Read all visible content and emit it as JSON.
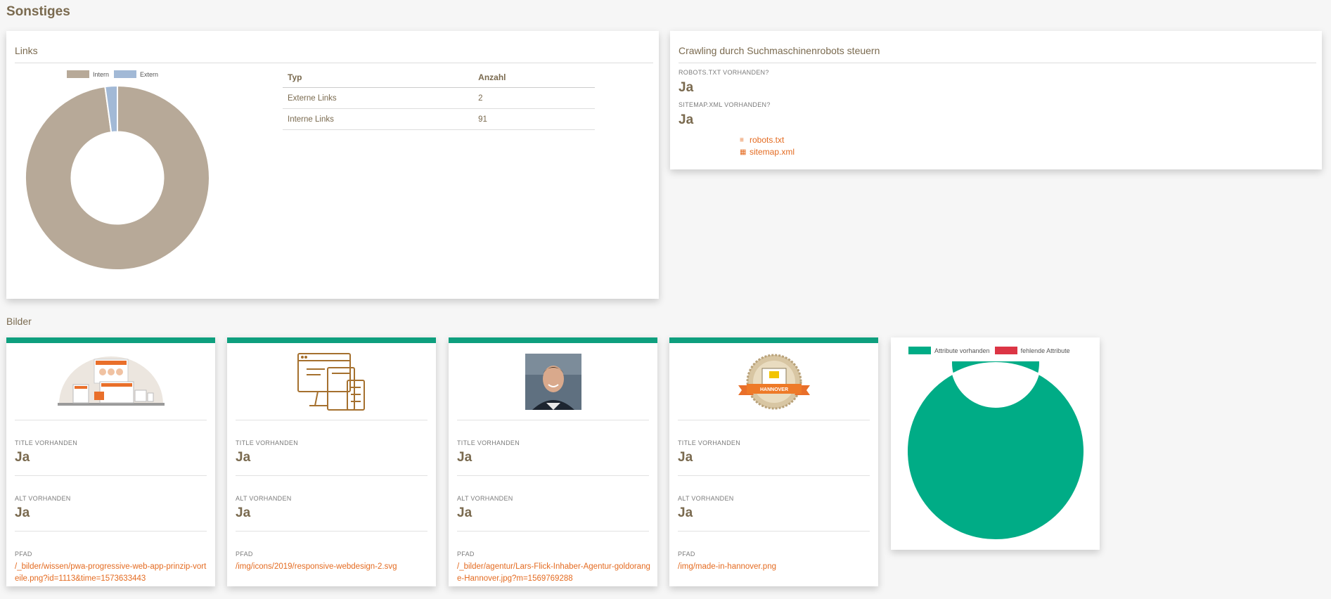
{
  "sections": {
    "sonstiges": "Sonstiges",
    "bilder": "Bilder"
  },
  "links": {
    "title": "Links",
    "legend": [
      {
        "label": "Intern",
        "color": "#b7a998"
      },
      {
        "label": "Extern",
        "color": "#a2b9d6"
      }
    ],
    "table": {
      "headers": [
        "Typ",
        "Anzahl"
      ],
      "rows": [
        {
          "typ": "Externe Links",
          "anzahl": "2"
        },
        {
          "typ": "Interne Links",
          "anzahl": "91"
        }
      ]
    }
  },
  "crawling": {
    "title": "Crawling durch Suchmaschinenrobots steuern",
    "robots_label": "ROBOTS.TXT VORHANDEN?",
    "robots_value": "Ja",
    "sitemap_label": "SITEMAP.XML VORHANDEN?",
    "sitemap_value": "Ja",
    "robots_link": "robots.txt",
    "sitemap_link": "sitemap.xml"
  },
  "images": [
    {
      "title_label": "TITLE VORHANDEN",
      "title_value": "Ja",
      "alt_label": "ALT VORHANDEN",
      "alt_value": "Ja",
      "pfad_label": "PFAD",
      "pfad": "/_bilder/wissen/pwa-progressive-web-app-prinzip-vorteile.png?id=1113&time=1573633443"
    },
    {
      "title_label": "TITLE VORHANDEN",
      "title_value": "Ja",
      "alt_label": "ALT VORHANDEN",
      "alt_value": "Ja",
      "pfad_label": "PFAD",
      "pfad": "/img/icons/2019/responsive-webdesign-2.svg"
    },
    {
      "title_label": "TITLE VORHANDEN",
      "title_value": "Ja",
      "alt_label": "ALT VORHANDEN",
      "alt_value": "Ja",
      "pfad_label": "PFAD",
      "pfad": "/_bilder/agentur/Lars-Flick-Inhaber-Agentur-goldorange-Hannover.jpg?m=1569769288"
    },
    {
      "title_label": "TITLE VORHANDEN",
      "title_value": "Ja",
      "alt_label": "ALT VORHANDEN",
      "alt_value": "Ja",
      "pfad_label": "PFAD",
      "pfad": "/img/made-in-hannover.png",
      "badge_text": "HANNOVER"
    }
  ],
  "colors": {
    "accent": "#0e9f7e",
    "link": "#e46b21",
    "green_chart": "#00ac86",
    "red_chart": "#dc3545"
  },
  "chart_data": [
    {
      "type": "pie",
      "categories": [
        "Intern",
        "Extern"
      ],
      "values": [
        91,
        2
      ],
      "colors": [
        "#b7a998",
        "#a2b9d6"
      ],
      "legend": "top"
    },
    {
      "type": "pie",
      "categories": [
        "Attribute vorhanden",
        "fehlende Attribute"
      ],
      "values": [
        4,
        0
      ],
      "colors": [
        "#00ac86",
        "#dc3545"
      ],
      "legend": "top"
    }
  ]
}
